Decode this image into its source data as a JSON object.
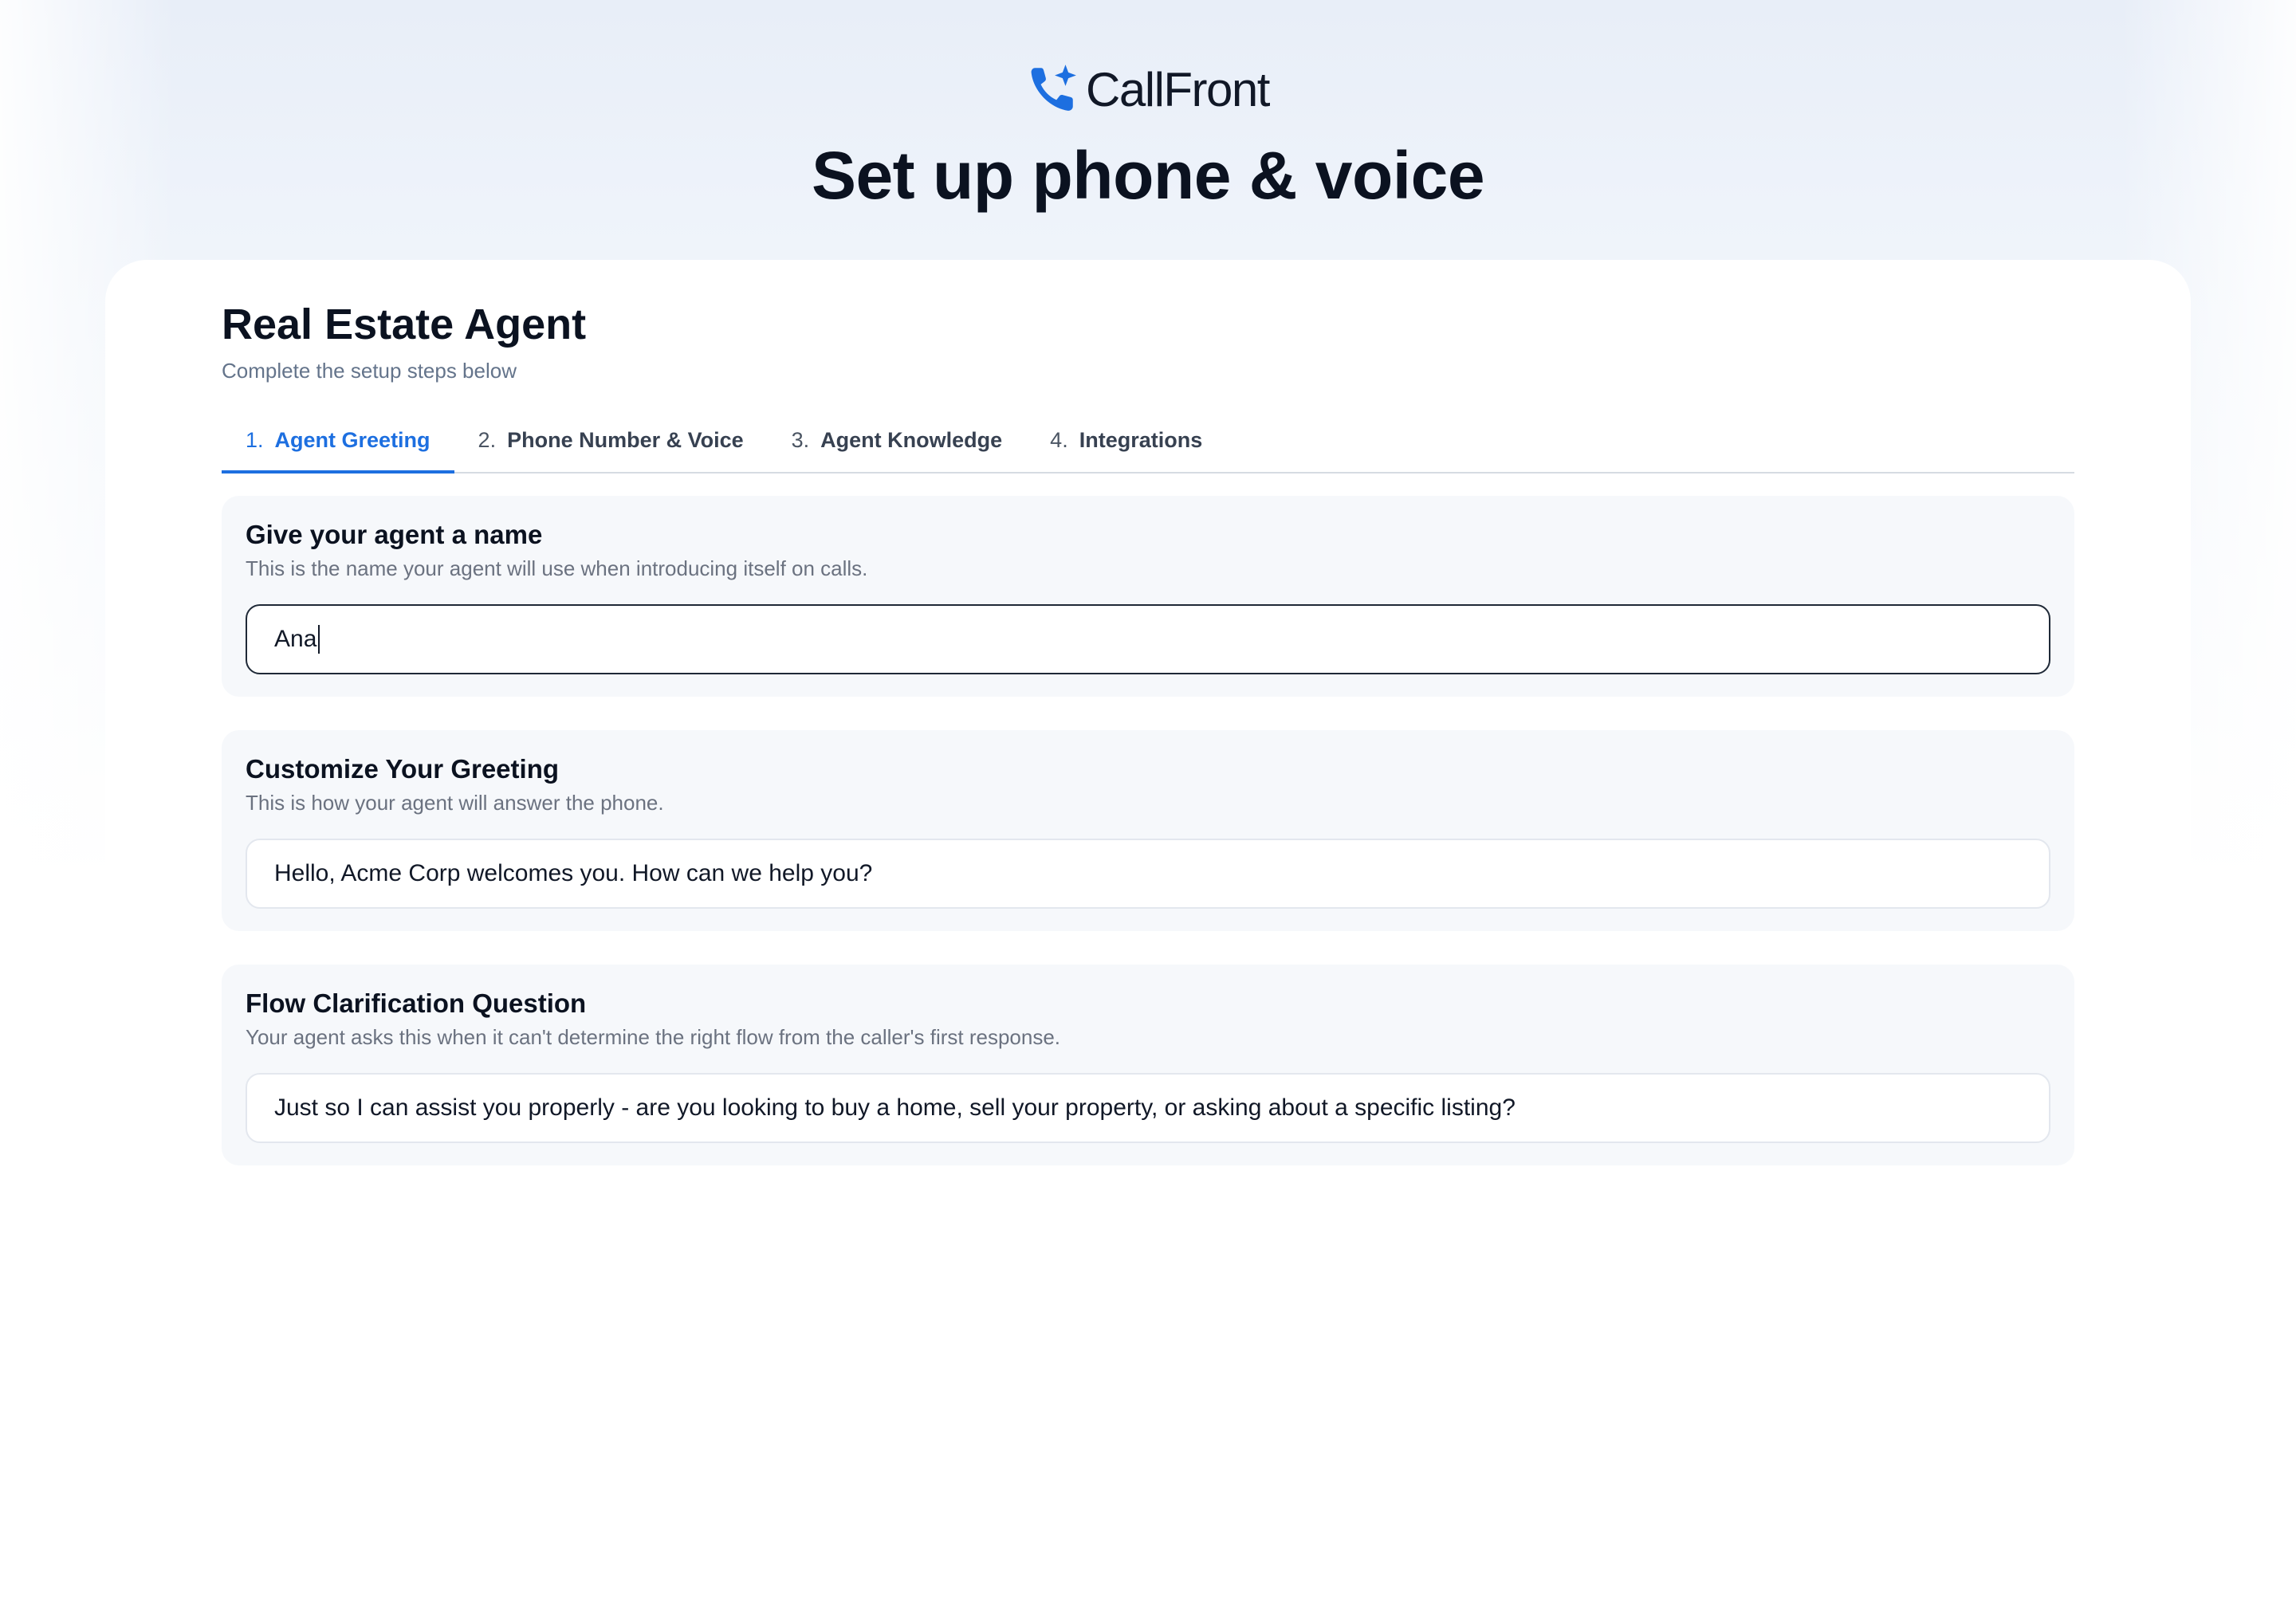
{
  "brand": {
    "name": "CallFront",
    "accent": "#1d6fe0",
    "logo_icon": "phone-sparkle-icon"
  },
  "page": {
    "title": "Set up phone & voice"
  },
  "agent": {
    "title": "Real Estate Agent",
    "subtitle": "Complete the setup steps below"
  },
  "tabs": [
    {
      "num": "1.",
      "label": "Agent Greeting",
      "active": true
    },
    {
      "num": "2.",
      "label": "Phone Number & Voice",
      "active": false
    },
    {
      "num": "3.",
      "label": "Agent Knowledge",
      "active": false
    },
    {
      "num": "4.",
      "label": "Integrations",
      "active": false
    }
  ],
  "sections": {
    "name": {
      "title": "Give your agent a name",
      "description": "This is the name your agent will use when introducing itself on calls.",
      "value": "Ana"
    },
    "greeting": {
      "title": "Customize Your Greeting",
      "description": "This is how your agent will answer the phone.",
      "value": "Hello, Acme Corp welcomes you. How can we help you?"
    },
    "clarification": {
      "title": "Flow Clarification Question",
      "description": "Your agent asks this when it can't determine the right flow from the caller's first response.",
      "value": "Just so I can assist you properly - are you looking to buy a home, sell your property, or asking about a specific listing?"
    }
  }
}
